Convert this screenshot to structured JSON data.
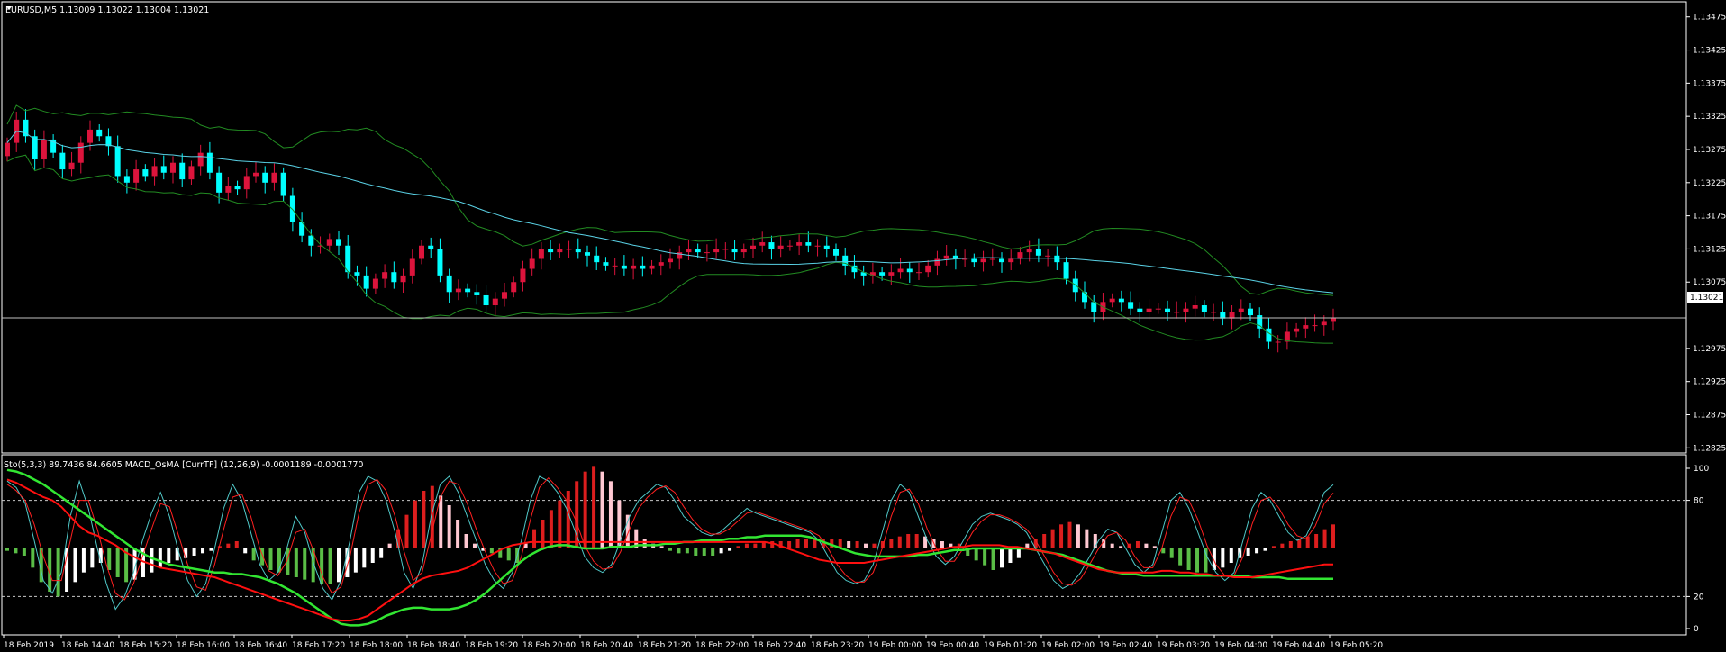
{
  "main_pane": {
    "symbol_header": "EURUSD,M5  1.13009 1.13022 1.13004 1.13021",
    "current_price": "1.13021",
    "price_ticks": [
      "1.13475",
      "1.13425",
      "1.13375",
      "1.13325",
      "1.13275",
      "1.13225",
      "1.13175",
      "1.13125",
      "1.13075",
      "1.12975",
      "1.12925",
      "1.12875",
      "1.12825"
    ]
  },
  "indicator_pane": {
    "header": "Sto(5,3,3) 89.7436 84.6605  MACD_OsMA [CurrTF] (12,26,9) -0.0001189 -0.0001770",
    "level_ticks": [
      "100",
      "80",
      "20",
      "0"
    ]
  },
  "time_axis": {
    "labels": [
      "18 Feb 2019",
      "18 Feb 14:40",
      "18 Feb 15:20",
      "18 Feb 16:00",
      "18 Feb 16:40",
      "18 Feb 17:20",
      "18 Feb 18:00",
      "18 Feb 18:40",
      "18 Feb 19:20",
      "18 Feb 20:00",
      "18 Feb 20:40",
      "18 Feb 21:20",
      "18 Feb 22:00",
      "18 Feb 22:40",
      "18 Feb 23:20",
      "19 Feb 00:00",
      "19 Feb 00:40",
      "19 Feb 01:20",
      "19 Feb 02:00",
      "19 Feb 02:40",
      "19 Feb 03:20",
      "19 Feb 04:00",
      "19 Feb 04:40",
      "19 Feb 05:20"
    ]
  },
  "colors": {
    "bull": "#dc143c",
    "bear": "#00ffff",
    "bands": "#228b22",
    "ma": "#5ad2e6",
    "hist_up": "#dc1e1e",
    "hist_down": "#5abe46",
    "hist_pale": "#ffc8d2",
    "stoch_main": "#50c8c8",
    "stoch_signal": "#ff2020",
    "osma_signal": "#32e632",
    "osma_main": "#ff1010"
  },
  "chart_data": [
    {
      "type": "candlestick",
      "series": [
        {
          "name": "EURUSD,M5",
          "close": [
            1.13285,
            1.1332,
            1.13295,
            1.1326,
            1.1329,
            1.1327,
            1.13245,
            1.13255,
            1.13285,
            1.13305,
            1.13295,
            1.1328,
            1.13235,
            1.13225,
            1.13245,
            1.13235,
            1.1325,
            1.1324,
            1.13255,
            1.1323,
            1.1325,
            1.1327,
            1.1324,
            1.1321,
            1.1322,
            1.13215,
            1.13235,
            1.1324,
            1.13225,
            1.1324,
            1.13205,
            1.13165,
            1.13145,
            1.1313,
            1.1313,
            1.1314,
            1.1313,
            1.1309,
            1.13085,
            1.13065,
            1.1308,
            1.1309,
            1.13075,
            1.13085,
            1.1311,
            1.1313,
            1.13125,
            1.13085,
            1.1306,
            1.13065,
            1.1306,
            1.13055,
            1.1304,
            1.1305,
            1.1306,
            1.13075,
            1.13095,
            1.1311,
            1.13125,
            1.1312,
            1.13125,
            1.13125,
            1.1312,
            1.13115,
            1.13105,
            1.131,
            1.131,
            1.13095,
            1.131,
            1.13095,
            1.131,
            1.13105,
            1.1311,
            1.1312,
            1.13125,
            1.1312,
            1.1312,
            1.13125,
            1.13125,
            1.1312,
            1.13125,
            1.1313,
            1.13135,
            1.13125,
            1.1313,
            1.1313,
            1.13135,
            1.1313,
            1.1313,
            1.13125,
            1.13115,
            1.131,
            1.1309,
            1.13085,
            1.1309,
            1.13085,
            1.1309,
            1.13095,
            1.1309,
            1.1309,
            1.131,
            1.1311,
            1.13115,
            1.1311,
            1.1311,
            1.13105,
            1.1311,
            1.1311,
            1.13105,
            1.1311,
            1.1312,
            1.13125,
            1.13115,
            1.13115,
            1.13105,
            1.1308,
            1.1306,
            1.13045,
            1.1303,
            1.13045,
            1.1305,
            1.13045,
            1.13035,
            1.1303,
            1.13035,
            1.13035,
            1.1303,
            1.1303,
            1.13035,
            1.1304,
            1.1303,
            1.1303,
            1.1302,
            1.1303,
            1.13035,
            1.13025,
            1.13005,
            1.12985,
            1.12985,
            1.13,
            1.13005,
            1.1301,
            1.1301,
            1.13015,
            1.13021
          ]
        }
      ],
      "ylim": [
        1.1282,
        1.13495
      ]
    },
    {
      "type": "line",
      "series": [
        {
          "name": "Sto(5,3,3)",
          "values": [
            92,
            88,
            78,
            55,
            30,
            22,
            35,
            70,
            92,
            75,
            50,
            28,
            12,
            20,
            35,
            55,
            72,
            85,
            70,
            48,
            30,
            20,
            28,
            50,
            75,
            90,
            80,
            60,
            40,
            30,
            35,
            50,
            70,
            60,
            40,
            25,
            18,
            30,
            55,
            85,
            95,
            92,
            80,
            60,
            35,
            25,
            40,
            70,
            90,
            95,
            85,
            70,
            55,
            40,
            30,
            25,
            35,
            55,
            80,
            95,
            92,
            85,
            75,
            60,
            45,
            38,
            35,
            40,
            55,
            70,
            80,
            85,
            90,
            88,
            80,
            70,
            65,
            60,
            58,
            60,
            65,
            70,
            75,
            72,
            70,
            68,
            66,
            64,
            62,
            60,
            55,
            45,
            35,
            30,
            28,
            30,
            40,
            60,
            80,
            90,
            85,
            70,
            55,
            45,
            40,
            45,
            55,
            65,
            70,
            72,
            70,
            68,
            65,
            60,
            50,
            40,
            30,
            25,
            28,
            35,
            45,
            55,
            62,
            60,
            50,
            40,
            35,
            40,
            60,
            80,
            85,
            75,
            60,
            45,
            35,
            30,
            35,
            55,
            75,
            85,
            80,
            70,
            60,
            55,
            58,
            70,
            85,
            89.7436
          ]
        },
        {
          "name": "Sto(5,3,3) signal",
          "values": [
            90,
            86,
            80,
            65,
            45,
            30,
            30,
            55,
            80,
            80,
            62,
            40,
            22,
            18,
            28,
            45,
            62,
            78,
            76,
            58,
            40,
            26,
            24,
            40,
            62,
            82,
            84,
            70,
            50,
            36,
            33,
            42,
            60,
            62,
            48,
            32,
            22,
            26,
            45,
            72,
            90,
            93,
            86,
            70,
            48,
            30,
            35,
            58,
            82,
            92,
            90,
            78,
            62,
            48,
            36,
            28,
            30,
            45,
            68,
            88,
            94,
            88,
            80,
            68,
            52,
            42,
            37,
            38,
            48,
            62,
            75,
            82,
            87,
            89,
            85,
            76,
            68,
            62,
            59,
            59,
            62,
            67,
            72,
            73,
            71,
            69,
            67,
            65,
            63,
            61,
            58,
            50,
            40,
            33,
            29,
            29,
            35,
            50,
            70,
            85,
            87,
            78,
            62,
            50,
            42,
            42,
            50,
            60,
            67,
            71,
            71,
            69,
            66,
            62,
            55,
            45,
            35,
            28,
            27,
            31,
            40,
            50,
            58,
            60,
            55,
            45,
            38,
            38,
            50,
            70,
            82,
            80,
            68,
            52,
            40,
            33,
            33,
            45,
            65,
            80,
            82,
            75,
            65,
            58,
            56,
            64,
            78,
            84.6605
          ]
        },
        {
          "name": "MACD_OsMA",
          "values": [
            99,
            98,
            96,
            93,
            90,
            86,
            82,
            78,
            74,
            70,
            66,
            62,
            58,
            54,
            50,
            47,
            44,
            42,
            40,
            39,
            38,
            37,
            36,
            35,
            35,
            34,
            34,
            33,
            32,
            30,
            28,
            25,
            22,
            18,
            14,
            10,
            6,
            3,
            2,
            2,
            3,
            5,
            8,
            10,
            12,
            13,
            13,
            12,
            12,
            12,
            13,
            15,
            18,
            22,
            27,
            32,
            37,
            42,
            46,
            49,
            51,
            52,
            52,
            51,
            50,
            50,
            50,
            51,
            51,
            51,
            52,
            52,
            52,
            53,
            53,
            54,
            54,
            55,
            55,
            55,
            56,
            56,
            57,
            57,
            58,
            58,
            58,
            58,
            58,
            57,
            55,
            53,
            51,
            49,
            47,
            46,
            45,
            45,
            45,
            45,
            45,
            46,
            46,
            47,
            48,
            49,
            49,
            50,
            50,
            50,
            50,
            50,
            50,
            50,
            49,
            48,
            47,
            46,
            44,
            42,
            40,
            38,
            36,
            35,
            34,
            34,
            33,
            33,
            33,
            33,
            33,
            33,
            33,
            33,
            33,
            33,
            33,
            33,
            32,
            32,
            32,
            32,
            31,
            31,
            31,
            31,
            31,
            31
          ]
        },
        {
          "name": "MACD_OsMA signal",
          "values": [
            93,
            91,
            88,
            85,
            82,
            80,
            76,
            70,
            64,
            60,
            58,
            55,
            52,
            48,
            45,
            42,
            40,
            38,
            37,
            36,
            35,
            34,
            33,
            32,
            30,
            28,
            26,
            24,
            22,
            20,
            18,
            16,
            14,
            12,
            10,
            8,
            6,
            5,
            5,
            6,
            8,
            12,
            16,
            20,
            24,
            28,
            31,
            33,
            34,
            35,
            36,
            38,
            41,
            44,
            47,
            50,
            52,
            53,
            54,
            54,
            54,
            54,
            54,
            54,
            54,
            54,
            54,
            54,
            54,
            54,
            54,
            54,
            54,
            54,
            54,
            54,
            54,
            54,
            54,
            54,
            54,
            54,
            54,
            54,
            54,
            53,
            51,
            49,
            47,
            45,
            43,
            42,
            41,
            41,
            41,
            41,
            42,
            43,
            44,
            45,
            46,
            47,
            48,
            49,
            50,
            51,
            51,
            52,
            52,
            52,
            52,
            51,
            51,
            50,
            49,
            48,
            47,
            45,
            43,
            41,
            39,
            37,
            36,
            35,
            35,
            35,
            35,
            35,
            36,
            36,
            35,
            35,
            34,
            34,
            33,
            33,
            32,
            32,
            32,
            33,
            34,
            35,
            36,
            37,
            38,
            39,
            40,
            40
          ]
        }
      ],
      "ylim": [
        0,
        100
      ]
    },
    {
      "type": "bar",
      "series": [
        {
          "name": "MACD_OsMA histogram",
          "values": [
            -1,
            -2,
            -3,
            -8,
            -14,
            -18,
            -20,
            -18,
            -14,
            -10,
            -8,
            -6,
            -9,
            -12,
            -14,
            -13,
            -12,
            -10,
            -8,
            -6,
            -5,
            -4,
            -3,
            -2,
            -1,
            1,
            2,
            3,
            -2,
            -5,
            -7,
            -9,
            -10,
            -11,
            -12,
            -13,
            -14,
            -15,
            -15,
            -14,
            -12,
            -10,
            -8,
            -6,
            -4,
            2,
            8,
            14,
            20,
            24,
            26,
            22,
            18,
            12,
            6,
            2,
            -1,
            -2,
            -4,
            -5,
            -6,
            2,
            8,
            12,
            16,
            20,
            24,
            28,
            32,
            34,
            32,
            28,
            20,
            14,
            8,
            4,
            2,
            1,
            -1,
            -2,
            -2,
            -3,
            -3,
            -3,
            -2,
            -1,
            1,
            2,
            2,
            3,
            3,
            3,
            3,
            4,
            4,
            4,
            4,
            4,
            4,
            3,
            3,
            2,
            2,
            3,
            4,
            5,
            6,
            6,
            5,
            4,
            3,
            2,
            2,
            -3,
            -5,
            -7,
            -9,
            -8,
            -6,
            -4,
            2,
            4,
            6,
            8,
            10,
            11,
            10,
            8,
            6,
            4,
            2,
            1,
            2,
            3,
            2,
            1,
            -2,
            -4,
            -7,
            -9,
            -10,
            -10,
            -9,
            -8,
            -6,
            -4,
            -3,
            -2,
            -1,
            1,
            2,
            3,
            4,
            5,
            6,
            8,
            10
          ]
        }
      ],
      "ylim": [
        -30,
        30
      ]
    }
  ]
}
